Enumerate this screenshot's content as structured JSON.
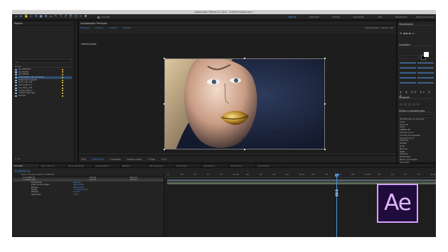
{
  "window": {
    "title": "Adobe After Effects CC 2015 - Untitled Project.aep *"
  },
  "colors": {
    "accent": "#4a90e2",
    "logo_border": "#d4a2ff",
    "logo_text": "#e3b6ff",
    "logo_bg": "#1f0c3d"
  },
  "toolbar": {
    "tools": [
      "home-icon",
      "selection-icon",
      "hand-icon",
      "zoom-icon",
      "rotate-icon",
      "camera-icon",
      "pan-behind-icon",
      "rectangle-icon",
      "pen-icon",
      "type-icon",
      "brush-icon",
      "clone-icon",
      "eraser-icon",
      "roto-icon",
      "puppet-icon"
    ],
    "tool_glyphs": [
      "⌂",
      "➤",
      "✋",
      "⌕",
      "⟲",
      "▣",
      "✥",
      "▭",
      "✎",
      "T",
      "✐",
      "⎘",
      "◫",
      "✂",
      "✱"
    ],
    "snap_label": "Encaixe",
    "workspaces": [
      "Padrão",
      "Aprender",
      "Padrão",
      "Animação",
      "Tudo",
      "Bibliotecas"
    ],
    "active_workspace_index": 0,
    "search_help": "Pesquisar ajuda"
  },
  "project": {
    "title": "Projeto",
    "header": "Nome",
    "items": [
      "01_SOLIDOS",
      "02_TEXTO",
      "03_FOTOS",
      "maquiagem_lips_dourado",
      "Camada de Ajuste",
      "Ouro_clip_v01",
      "Pré-comp Cor",
      "Luz_Tarja_v01",
      "Composição 1",
      "modelo_gold.jpg",
      "Sólidos"
    ],
    "selected_index": 3,
    "footer": "8 bpc"
  },
  "composition": {
    "panel_title": "Composição: Principal",
    "tabs": [
      "Principal",
      "Comp 1",
      "Comp 2",
      "Retrato"
    ],
    "active_camera": "Câmera ativa",
    "renderer": "Renderizador: Clássico 3D",
    "footer": [
      "50%",
      "0:00:03:11",
      "Completa",
      "Câmera ativa",
      "1 Vista",
      "+0,0"
    ]
  },
  "right_panel": {
    "sections": [
      "Visualização",
      "Caractere",
      "Parágrafo",
      "Efeitos e predefinições"
    ],
    "preview_controls": [
      "⏮",
      "◀",
      "▶",
      "▶",
      "⏭"
    ],
    "char_style_line": "T T TT Tt T T",
    "effects": [
      "Predefinições de animação",
      "Áudio",
      "Canal 3D",
      "Canal",
      "CINEMA 4D",
      "Controle de cor",
      "Controle de expressão",
      "Correção de cor",
      "Distorção",
      "Estilizar",
      "Gerar",
      "Máscara",
      "Matte",
      "Obsoleto",
      "Perspectiva",
      "Ruído e granulação",
      "Simulação",
      "Texto",
      "Tempo",
      "Transição",
      "Utilidade"
    ]
  },
  "timeline": {
    "tabs": [
      "Principal",
      "Pré-comp Cor",
      "Pré-comp Brilho",
      "Composição 1",
      "Retrato",
      "Pré-comp Luz",
      "Pré-comp 2",
      "Camada 01",
      "Luz final 01",
      "Luz final 02"
    ],
    "active_tab_index": 0,
    "current_time": "0:00:03:11",
    "header": "Nome da origem          Modo    T   TrkMat     Pai",
    "rows": [
      {
        "type": "layer",
        "label": "1  Luz Tarja 01",
        "val": "",
        "mode": "Normal",
        "parent": "Nenhum"
      },
      {
        "type": "layer",
        "label": "2  modelo_gold",
        "val": "",
        "mode": "Normal",
        "parent": "Nenhum",
        "selected": true
      },
      {
        "type": "sub",
        "label": "Transformar",
        "val": "Redefinir",
        "mode": "",
        "parent": ""
      },
      {
        "type": "sub",
        "label": "Ponto de ancoragem",
        "val": "960,0,540,0",
        "mode": "",
        "parent": ""
      },
      {
        "type": "sub",
        "label": "Posição",
        "val": "960,0,540,0",
        "mode": "",
        "parent": ""
      },
      {
        "type": "sub",
        "label": "Escala",
        "val": "∞ 100,0,100,0%",
        "mode": "",
        "parent": ""
      },
      {
        "type": "sub",
        "label": "Rotação",
        "val": "0x+0,0°",
        "mode": "",
        "parent": ""
      },
      {
        "type": "sub",
        "label": "Opacidade",
        "val": "100%",
        "mode": "",
        "parent": ""
      }
    ],
    "ticks": [
      "0f",
      "05f",
      "10f",
      "15f",
      "20f",
      "01:00f",
      "05f",
      "10f",
      "15f",
      "20f",
      "02:00f",
      "05f",
      "10f",
      "15f",
      "20f",
      "03:00f",
      "05f",
      "10f",
      "15f",
      "20f",
      "04:00f"
    ]
  },
  "logo": {
    "text": "Ae"
  }
}
